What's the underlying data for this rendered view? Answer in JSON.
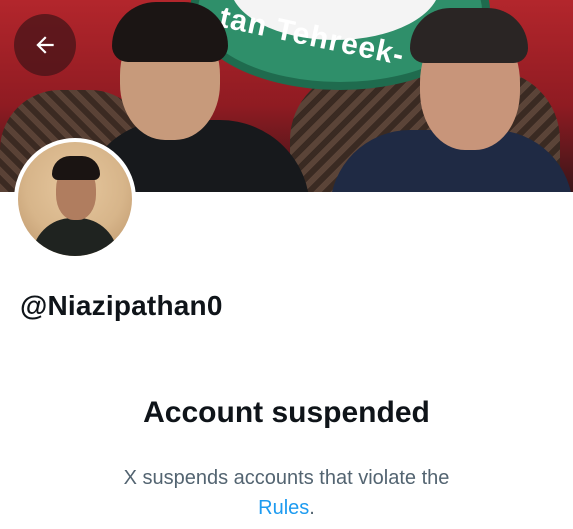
{
  "profile": {
    "handle": "@Niazipathan0"
  },
  "banner": {
    "text": "tan Tehreek-"
  },
  "suspension": {
    "title": "Account suspended",
    "message": "X suspends accounts that violate the",
    "link_label": "Rules",
    "suffix": "."
  },
  "icons": {
    "back": "arrow-left-icon"
  },
  "colors": {
    "link": "#1d9bf0",
    "secondary_text": "#536471"
  }
}
